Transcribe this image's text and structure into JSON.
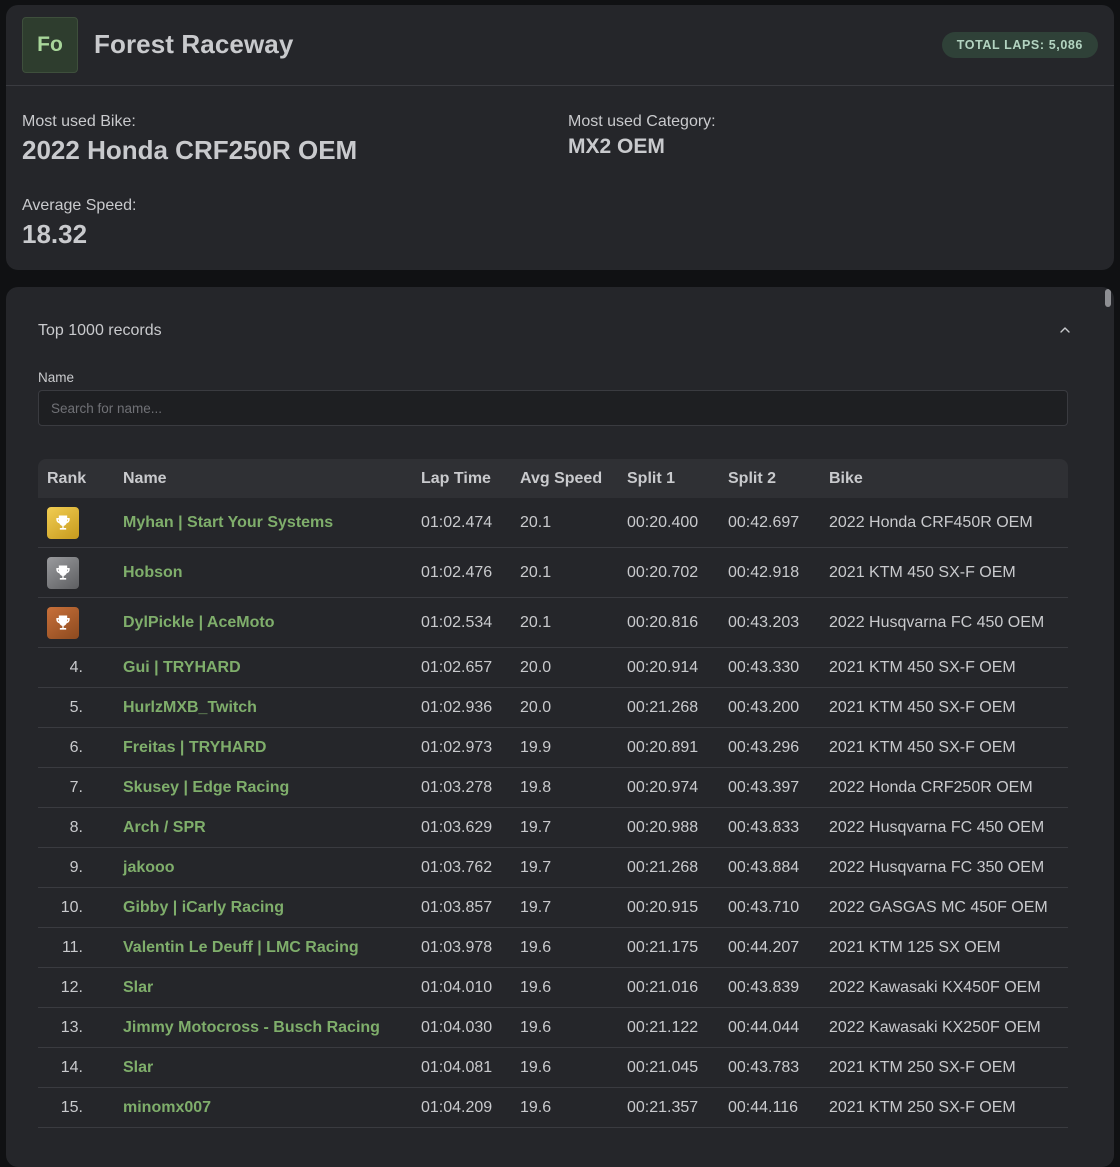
{
  "track": {
    "initials": "Fo",
    "name": "Forest Raceway",
    "total_laps_badge": "TOTAL LAPS: 5,086",
    "most_used_bike_label": "Most used Bike:",
    "most_used_bike": "2022 Honda CRF250R OEM",
    "most_used_category_label": "Most used Category:",
    "most_used_category": "MX2 OEM",
    "average_speed_label": "Average Speed:",
    "average_speed": "18.32"
  },
  "records": {
    "title": "Top 1000 records",
    "name_filter_label": "Name",
    "search_placeholder": "Search for name...",
    "columns": {
      "rank": "Rank",
      "name": "Name",
      "lap_time": "Lap Time",
      "avg_speed": "Avg Speed",
      "split1": "Split 1",
      "split2": "Split 2",
      "bike": "Bike"
    },
    "rows": [
      {
        "rank": "",
        "medal": "gold",
        "name": "Myhan | Start Your Systems",
        "lap_time": "01:02.474",
        "avg_speed": "20.1",
        "split1": "00:20.400",
        "split2": "00:42.697",
        "bike": "2022 Honda CRF450R OEM"
      },
      {
        "rank": "",
        "medal": "silver",
        "name": "Hobson",
        "lap_time": "01:02.476",
        "avg_speed": "20.1",
        "split1": "00:20.702",
        "split2": "00:42.918",
        "bike": "2021 KTM 450 SX-F OEM"
      },
      {
        "rank": "",
        "medal": "bronze",
        "name": "DylPickle | AceMoto",
        "lap_time": "01:02.534",
        "avg_speed": "20.1",
        "split1": "00:20.816",
        "split2": "00:43.203",
        "bike": "2022 Husqvarna FC 450 OEM"
      },
      {
        "rank": "4.",
        "medal": "",
        "name": "Gui | TRYHARD",
        "lap_time": "01:02.657",
        "avg_speed": "20.0",
        "split1": "00:20.914",
        "split2": "00:43.330",
        "bike": "2021 KTM 450 SX-F OEM"
      },
      {
        "rank": "5.",
        "medal": "",
        "name": "HurlzMXB_Twitch",
        "lap_time": "01:02.936",
        "avg_speed": "20.0",
        "split1": "00:21.268",
        "split2": "00:43.200",
        "bike": "2021 KTM 450 SX-F OEM"
      },
      {
        "rank": "6.",
        "medal": "",
        "name": "Freitas | TRYHARD",
        "lap_time": "01:02.973",
        "avg_speed": "19.9",
        "split1": "00:20.891",
        "split2": "00:43.296",
        "bike": "2021 KTM 450 SX-F OEM"
      },
      {
        "rank": "7.",
        "medal": "",
        "name": "Skusey | Edge Racing",
        "lap_time": "01:03.278",
        "avg_speed": "19.8",
        "split1": "00:20.974",
        "split2": "00:43.397",
        "bike": "2022 Honda CRF250R OEM"
      },
      {
        "rank": "8.",
        "medal": "",
        "name": "Arch / SPR",
        "lap_time": "01:03.629",
        "avg_speed": "19.7",
        "split1": "00:20.988",
        "split2": "00:43.833",
        "bike": "2022 Husqvarna FC 450 OEM"
      },
      {
        "rank": "9.",
        "medal": "",
        "name": "jakooo",
        "lap_time": "01:03.762",
        "avg_speed": "19.7",
        "split1": "00:21.268",
        "split2": "00:43.884",
        "bike": "2022 Husqvarna FC 350 OEM"
      },
      {
        "rank": "10.",
        "medal": "",
        "name": "Gibby | iCarly Racing",
        "lap_time": "01:03.857",
        "avg_speed": "19.7",
        "split1": "00:20.915",
        "split2": "00:43.710",
        "bike": "2022 GASGAS MC 450F OEM"
      },
      {
        "rank": "11.",
        "medal": "",
        "name": "Valentin Le Deuff | LMC Racing",
        "lap_time": "01:03.978",
        "avg_speed": "19.6",
        "split1": "00:21.175",
        "split2": "00:44.207",
        "bike": "2021 KTM 125 SX OEM"
      },
      {
        "rank": "12.",
        "medal": "",
        "name": "Slar",
        "lap_time": "01:04.010",
        "avg_speed": "19.6",
        "split1": "00:21.016",
        "split2": "00:43.839",
        "bike": "2022 Kawasaki KX450F OEM"
      },
      {
        "rank": "13.",
        "medal": "",
        "name": "Jimmy Motocross - Busch Racing",
        "lap_time": "01:04.030",
        "avg_speed": "19.6",
        "split1": "00:21.122",
        "split2": "00:44.044",
        "bike": "2022 Kawasaki KX250F OEM"
      },
      {
        "rank": "14.",
        "medal": "",
        "name": "Slar",
        "lap_time": "01:04.081",
        "avg_speed": "19.6",
        "split1": "00:21.045",
        "split2": "00:43.783",
        "bike": "2021 KTM 250 SX-F OEM"
      },
      {
        "rank": "15.",
        "medal": "",
        "name": "minomx007",
        "lap_time": "01:04.209",
        "avg_speed": "19.6",
        "split1": "00:21.357",
        "split2": "00:44.116",
        "bike": "2021 KTM 250 SX-F OEM"
      }
    ]
  },
  "colors": {
    "background": "#101113",
    "card": "#25262a",
    "player_name": "#7fae6b",
    "badge_bg": "#2f4138",
    "gold": "#e0b53a",
    "silver": "#7b7c80",
    "bronze": "#b3602d"
  },
  "icons": {
    "medal": "trophy-icon",
    "collapse": "chevron-up-icon"
  }
}
